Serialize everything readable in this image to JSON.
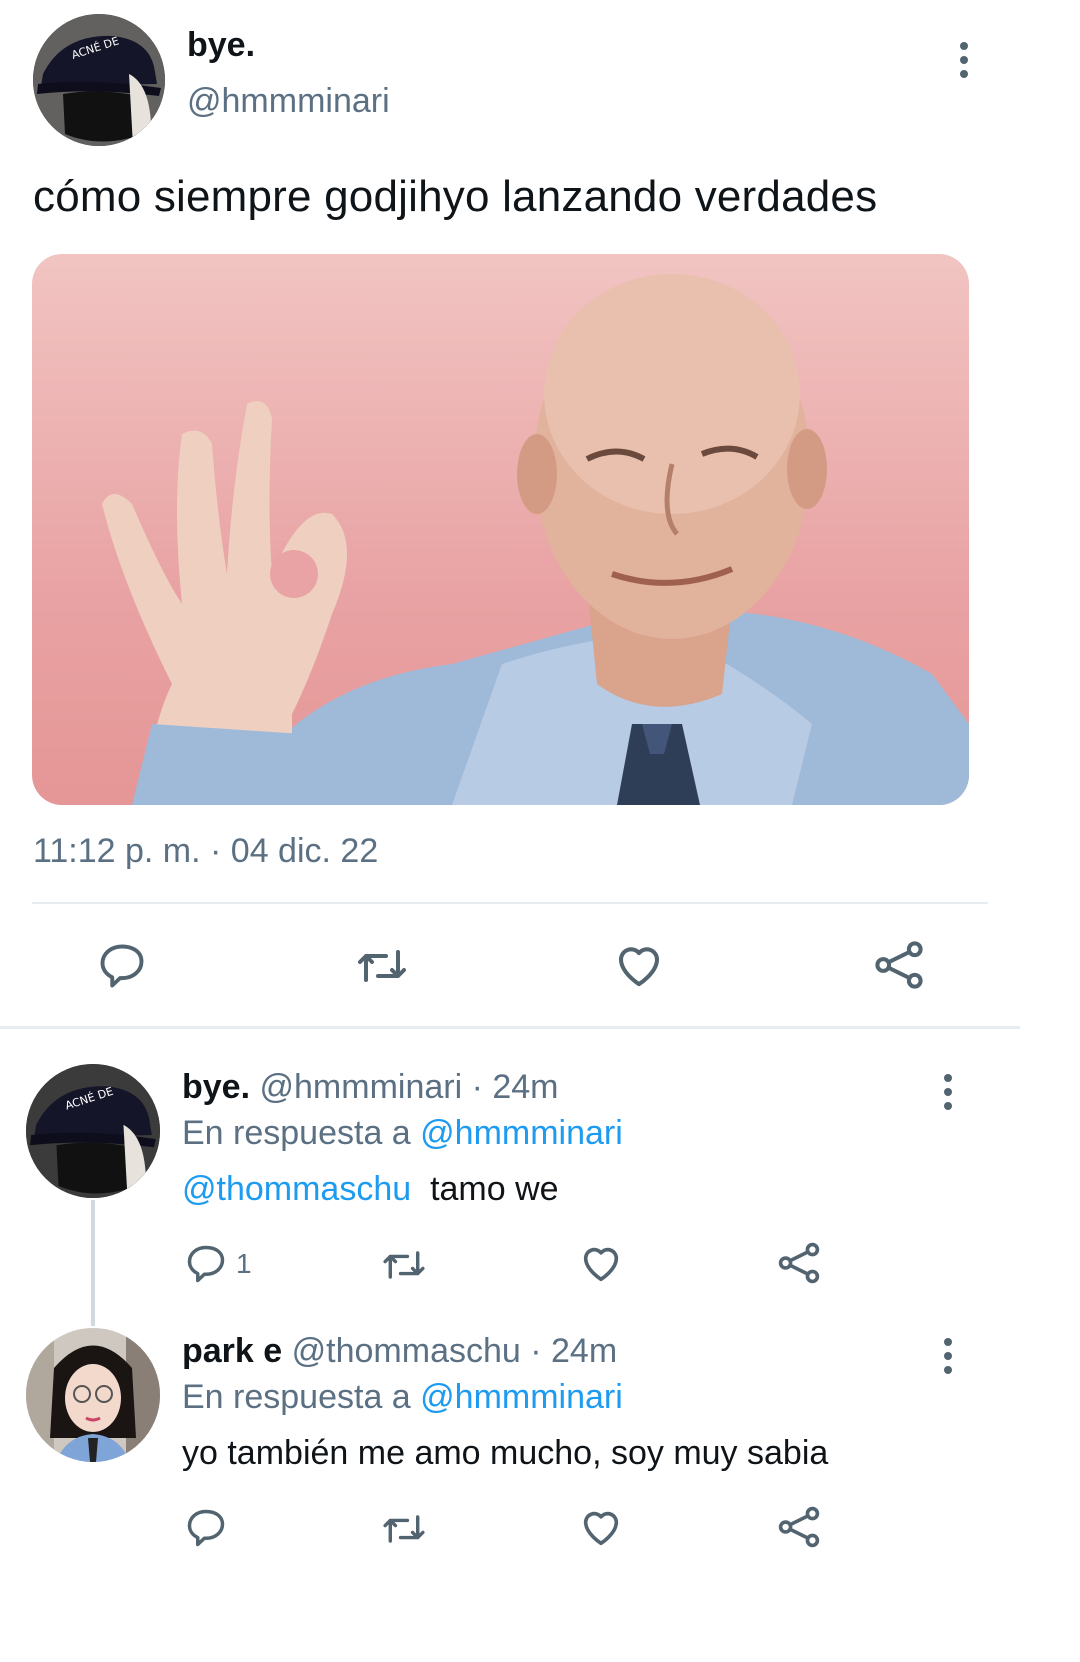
{
  "main_tweet": {
    "display_name": "bye.",
    "handle": "@hmmminari",
    "text": "cómo siempre godjihyo lanzando verdades",
    "timestamp": "11:12 p. m. · 04 dic. 22",
    "avatar_cap_text": "ACNÉ DE LA VIE",
    "media_description": "meme-photo-ok-hand-man"
  },
  "actions": {
    "reply_icon": "speech-bubble-icon",
    "retweet_icon": "retweet-icon",
    "like_icon": "heart-icon",
    "share_icon": "share-icon"
  },
  "replies": [
    {
      "display_name": "bye.",
      "handle": "@hmmminari",
      "time": "· 24m",
      "reply_prefix": "En respuesta a",
      "reply_to": "@hmmminari",
      "mention": "@thommaschu",
      "text": "tamo we",
      "reply_count": "1"
    },
    {
      "display_name": "park e",
      "handle": "@thommaschu",
      "time": "· 24m",
      "reply_prefix": "En respuesta a",
      "reply_to": "@hmmminari",
      "text": "yo también me amo mucho, soy muy sabia"
    }
  ],
  "colors": {
    "accent": "#1d9bf0",
    "muted": "#5b7083",
    "photo_background": "#e9a3a4"
  }
}
